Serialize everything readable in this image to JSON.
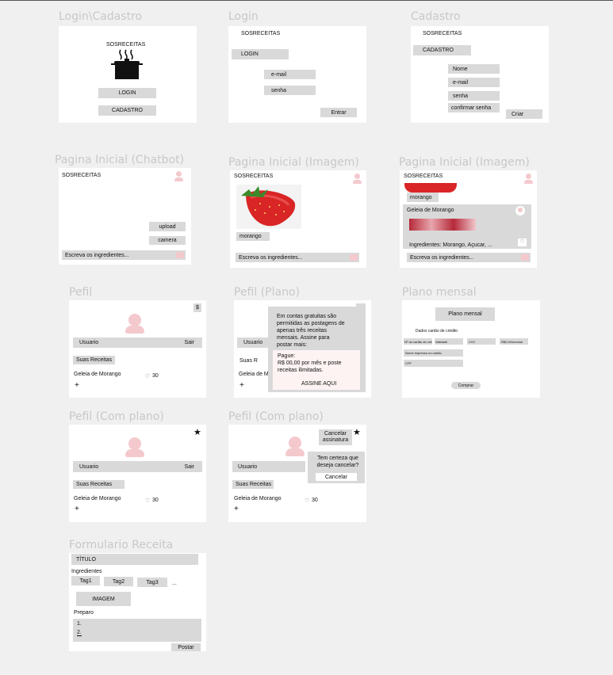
{
  "screens": {
    "login_cadastro": {
      "title": "Login\\Cadastro",
      "brand": "SOSRECEITAS",
      "login": "LOGIN",
      "cadastro": "CADASTRO"
    },
    "login": {
      "title": "Login",
      "brand": "SOSRECEITAS",
      "header": "LOGIN",
      "email": "e-mail",
      "senha": "senha",
      "entrar": "Entrar"
    },
    "cadastro": {
      "title": "Cadastro",
      "brand": "SOSRECEITAS",
      "header": "CADASTRO",
      "nome": "Nome",
      "email": "e-mail",
      "senha": "senha",
      "confirmar": "confirmar senha",
      "criar": "Criar"
    },
    "chatbot": {
      "title": "Pagina Inicial (Chatbot)",
      "brand": "SOSRECEITAS",
      "upload": "upload",
      "camera": "camera",
      "input": "Escreva os ingredientes..."
    },
    "imagem1": {
      "title": "Pagina Inicial (Imagem)",
      "brand": "SOSRECEITAS",
      "tag": "morango",
      "input": "Escreva os ingredientes..."
    },
    "imagem2": {
      "title": "Pagina Inicial (Imagem)",
      "brand": "SOSRECEITAS",
      "tag": "morango",
      "recipe": "Geleia de Morango",
      "ingredients": "Ingredientes: Morango, Açucar, ...",
      "input": "Escreva os ingredientes..."
    },
    "perfil": {
      "title": "Pefil",
      "dollar": "$",
      "user": "Usuario",
      "sair": "Sair",
      "suas": "Suas Receitas",
      "recipe": "Geleia de Morango",
      "likes": "30",
      "plus": "+"
    },
    "perfil_plano": {
      "title": "Pefil (Plano)",
      "user": "Usuario",
      "suas": "Suas R",
      "recipe": "Geleia de M",
      "plus": "+",
      "modal_text": "Em contas gratuitas são permitidas as postagens de apenas três receitas mensais. Assine para postar mais:",
      "pague": "Pague:",
      "price": "R$ 00,00 por mês e poste receitas ilimitadas.",
      "assine": "ASSINE AQUI"
    },
    "plano_mensal": {
      "title": "Plano mensal",
      "header": "Plano mensal",
      "dados": "Dados cartão de crédito",
      "f1": "Nº do cartão de crédito",
      "f2": "Validade",
      "f3": "CVV",
      "f4": "R$0,00/mensal",
      "f5": "Nome impresso no cartão",
      "f6": "CPF",
      "comprar": "Comprar"
    },
    "perfil_com_plano": {
      "title": "Pefil (Com plano)",
      "star": "★",
      "user": "Usuario",
      "sair": "Sair",
      "suas": "Suas Receitas",
      "recipe": "Geleia de Morango",
      "likes": "30",
      "plus": "+"
    },
    "perfil_com_plano2": {
      "title": "Pefil (Com plano)",
      "cancel_sub": "Cancelar assinatura",
      "star": "★",
      "user": "Usuario",
      "suas": "Suas Receitas",
      "recipe": "Geleia de Morango",
      "likes": "30",
      "plus": "+",
      "confirm_text": "Tem certeza que deseja cancelar?",
      "cancel": "Cancelar"
    },
    "formulario": {
      "title": "Formulario Receita",
      "titulo": "TÍTULO",
      "ingredientes": "Ingredientes",
      "tag1": "Tag1",
      "tag2": "Tag2",
      "tag3": "Tag3",
      "more": "...",
      "imagem": "IMAGEM",
      "preparo": "Preparo",
      "step1": "1.",
      "step2": "2.",
      "postar": "Postar"
    }
  },
  "colors": {
    "frame": "#ffffff",
    "box": "#d9d9d9",
    "label": "#c8c8c8",
    "accent_pink": "#f4c9cd"
  }
}
